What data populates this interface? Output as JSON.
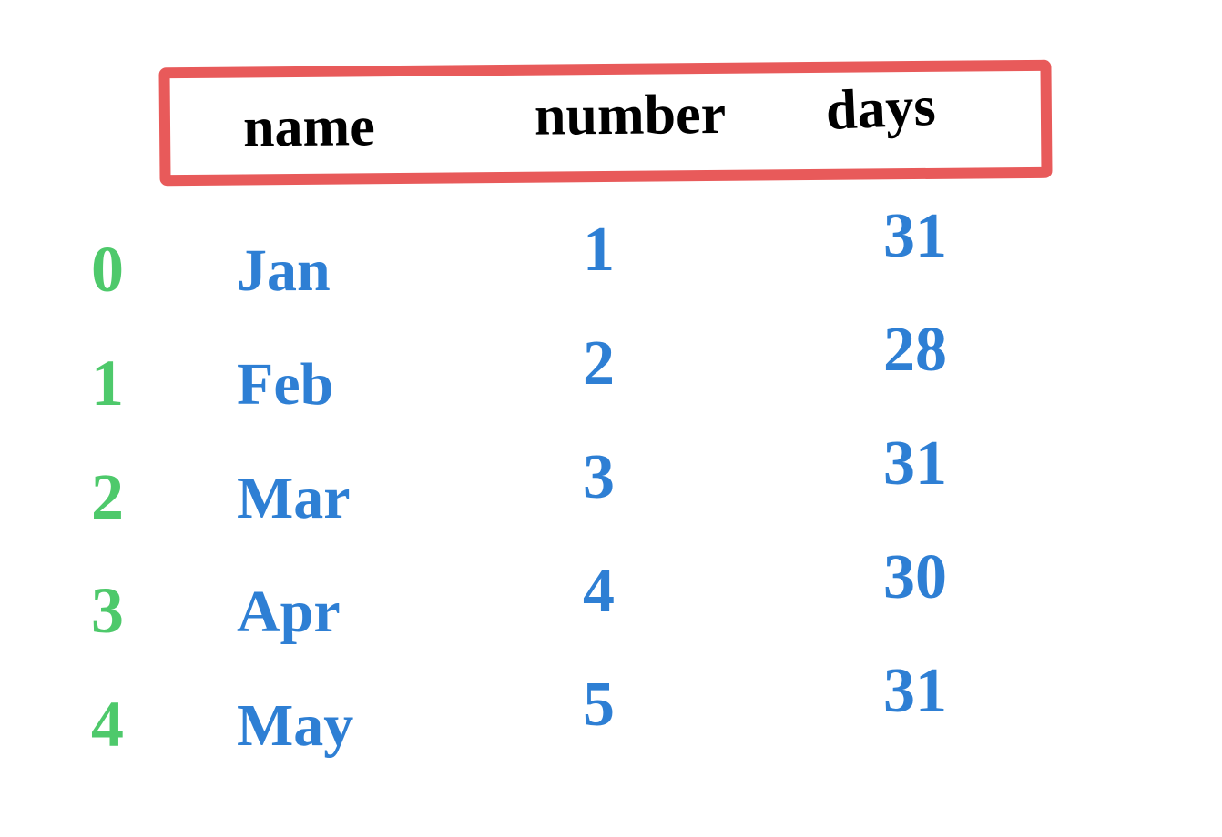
{
  "chart_data": {
    "type": "table",
    "columns": [
      "name",
      "number",
      "days"
    ],
    "index": [
      0,
      1,
      2,
      3,
      4
    ],
    "rows": [
      {
        "name": "Jan",
        "number": 1,
        "days": 31
      },
      {
        "name": "Feb",
        "number": 2,
        "days": 28
      },
      {
        "name": "Mar",
        "number": 3,
        "days": 31
      },
      {
        "name": "Apr",
        "number": 4,
        "days": 30
      },
      {
        "name": "May",
        "number": 5,
        "days": 31
      }
    ]
  },
  "colors": {
    "header_border": "#e85a5a",
    "header_text": "#000000",
    "index_text": "#4ec96b",
    "data_text": "#2e7fd4"
  }
}
